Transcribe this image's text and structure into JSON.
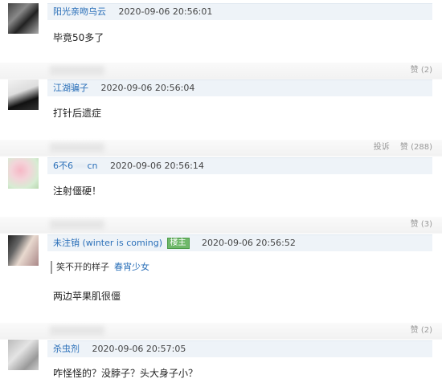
{
  "comments": [
    {
      "username": "阳光亲吻乌云",
      "timestamp": "2020-09-06 20:56:01",
      "text": "毕竟50多了",
      "like": "赞 (2)"
    },
    {
      "username": "江湖骗子",
      "timestamp": "2020-09-06 20:56:04",
      "text": "打针后遗症",
      "report": "投诉",
      "like": "赞 (288)"
    },
    {
      "username_prefix": "6不6",
      "username_suffix": "cn",
      "timestamp": "2020-09-06 20:56:14",
      "text": "注射僵硬！",
      "like": "赞 (3)"
    },
    {
      "username": "未注销 (winter is coming)",
      "badge": "楼主",
      "timestamp": "2020-09-06 20:56:52",
      "quote_text": "笑不开的样子",
      "quote_author": "春宵少女",
      "text": "两边苹果肌很僵",
      "like": "赞 (2)"
    },
    {
      "username": "杀虫剂",
      "timestamp": "2020-09-06 20:57:05",
      "text": "咋怪怪的？没脖子？头大身子小？"
    }
  ]
}
